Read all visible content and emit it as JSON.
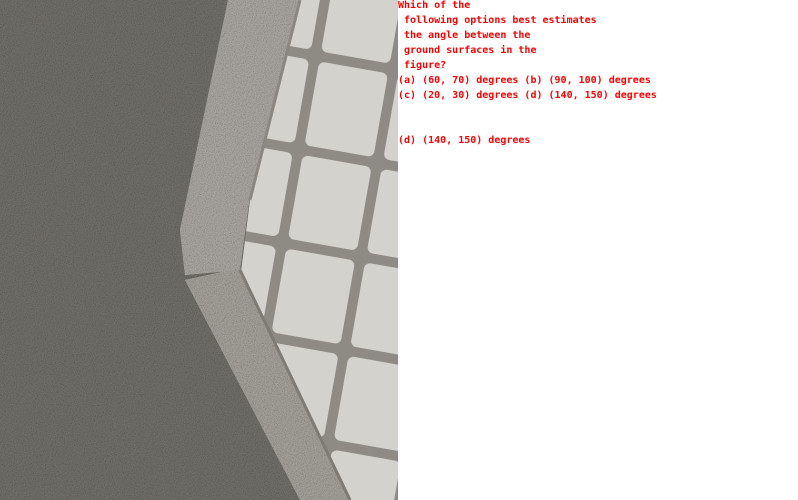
{
  "question": {
    "lines": [
      "Which of the",
      " following options best estimates",
      " the angle between the",
      " ground surfaces in the",
      " figure?",
      "(a) (60, 70) degrees (b) (90, 100) degrees",
      "(c) (20, 30) degrees (d) (140, 150) degrees"
    ]
  },
  "answer": "(d) (140, 150) degrees",
  "colors": {
    "text": "#ff0000",
    "asphalt": "#7b7975",
    "curb": "#b3b0aa",
    "tile": "#d2d1cc"
  }
}
